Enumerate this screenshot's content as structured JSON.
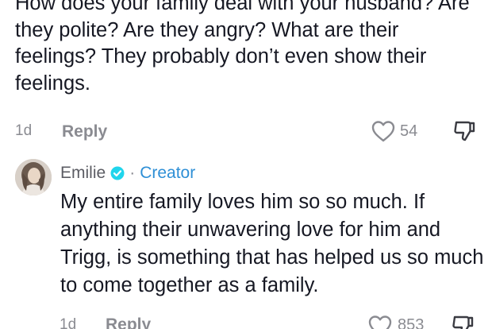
{
  "parent_comment": {
    "text": "How does your family deal with your husband? Are they polite? Are they angry? What are their feelings? They probably don’t even show their feelings.",
    "time": "1d",
    "reply_label": "Reply",
    "like_count": "54",
    "icons": {
      "like": "heart-outline-icon",
      "dislike": "thumbs-down-icon"
    }
  },
  "reply_comment": {
    "username": "Emilie",
    "verified": true,
    "separator": "·",
    "role_label": "Creator",
    "text": "My entire family loves him so so much. If anything their unwavering love for him and Trigg, is something that has helped us so much to come together as a family.",
    "time": "1d",
    "reply_label": "Reply",
    "like_count": "853",
    "icons": {
      "like": "heart-outline-icon",
      "dislike": "thumbs-down-icon",
      "verified": "verified-badge-icon"
    }
  },
  "colors": {
    "text": "#161823",
    "muted": "#8a8b91",
    "creator": "#2e8fd6",
    "verified": "#20d5ec"
  }
}
